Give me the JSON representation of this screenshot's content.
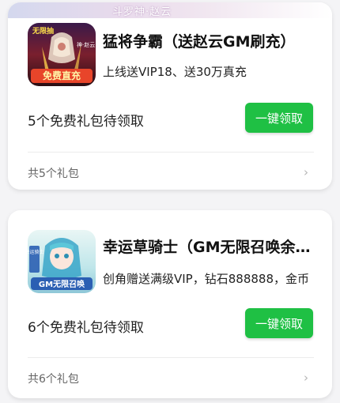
{
  "cards": [
    {
      "banner_text": "斗罗神·赵云",
      "icon": {
        "name": "game-icon-menjiang",
        "top_label": "无限抽",
        "side_label": "神·赵云",
        "bottom_label": "免费直充",
        "colors": {
          "bg": "#7a1f2e",
          "accent": "#f2c24a",
          "bottom": "#e8452a"
        }
      },
      "title": "猛将争霸（送赵云GM刷充）",
      "description": "上线送VIP18、送30万真充",
      "pending_text": "5个免费礼包待领取",
      "claim_button": "一键领取",
      "footer_text": "共5个礼包"
    },
    {
      "icon": {
        "name": "game-icon-xingyun",
        "side_label": "幸运骑士",
        "bottom_label": "GM无限召唤",
        "colors": {
          "bg": "#bfe6ea",
          "accent": "#3aa6c9",
          "bottom": "#2b5fb3"
        }
      },
      "title": "幸运草骑士（GM无限召唤余额）",
      "description": "创角赠送满级VIP，钻石888888，金币",
      "pending_text": "6个免费礼包待领取",
      "claim_button": "一键领取",
      "footer_text": "共6个礼包"
    }
  ],
  "colors": {
    "button": "#1fc044",
    "background": "#f4f4f6"
  }
}
